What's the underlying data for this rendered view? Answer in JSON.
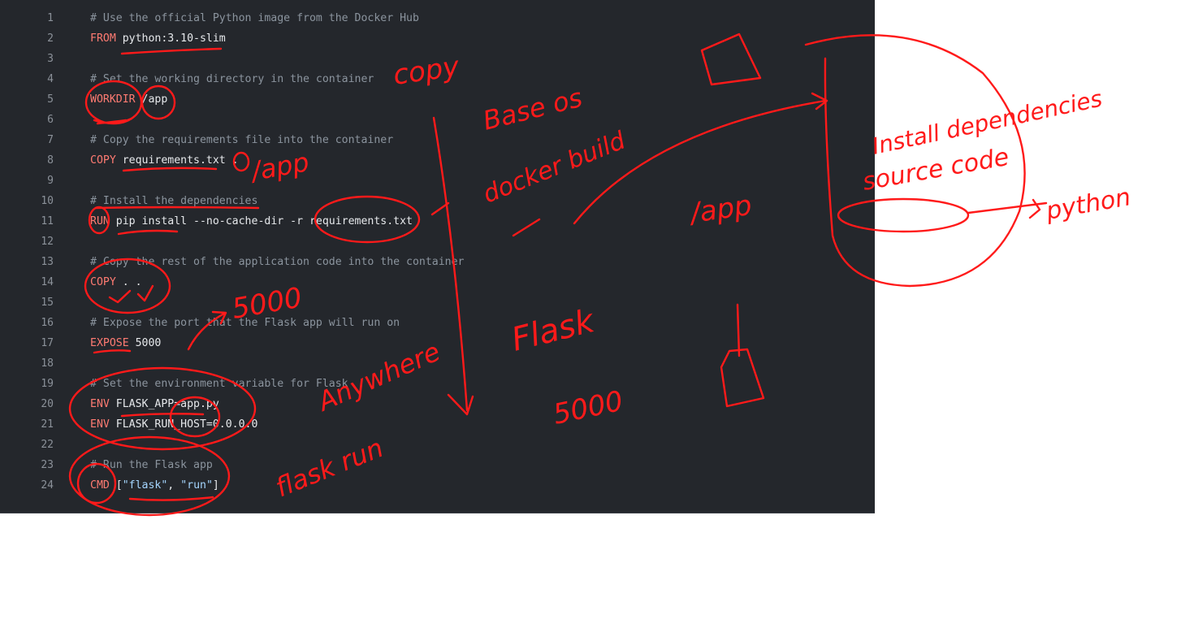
{
  "editor": {
    "lines": [
      {
        "n": "1",
        "parts": [
          {
            "t": "# Use the official Python image from the Docker Hub",
            "c": "cm"
          }
        ]
      },
      {
        "n": "2",
        "parts": [
          {
            "t": "FROM",
            "c": "kw"
          },
          {
            "t": " python:3.10-slim",
            "c": "tx"
          }
        ]
      },
      {
        "n": "3",
        "parts": []
      },
      {
        "n": "4",
        "parts": [
          {
            "t": "# Set the working directory in the container",
            "c": "cm"
          }
        ]
      },
      {
        "n": "5",
        "parts": [
          {
            "t": "WORKDIR",
            "c": "kw"
          },
          {
            "t": " /app",
            "c": "tx"
          }
        ]
      },
      {
        "n": "6",
        "parts": []
      },
      {
        "n": "7",
        "parts": [
          {
            "t": "# Copy the requirements file into the container",
            "c": "cm"
          }
        ]
      },
      {
        "n": "8",
        "parts": [
          {
            "t": "COPY",
            "c": "kw"
          },
          {
            "t": " requirements.txt .",
            "c": "tx"
          }
        ]
      },
      {
        "n": "9",
        "parts": []
      },
      {
        "n": "10",
        "parts": [
          {
            "t": "# Install the dependencies",
            "c": "cm"
          }
        ]
      },
      {
        "n": "11",
        "parts": [
          {
            "t": "RUN",
            "c": "kw"
          },
          {
            "t": " pip install --no-cache-dir -r requirements.txt",
            "c": "tx"
          }
        ]
      },
      {
        "n": "12",
        "parts": []
      },
      {
        "n": "13",
        "parts": [
          {
            "t": "# Copy the rest of the application code into the container",
            "c": "cm"
          }
        ]
      },
      {
        "n": "14",
        "parts": [
          {
            "t": "COPY",
            "c": "kw"
          },
          {
            "t": " . .",
            "c": "tx"
          }
        ]
      },
      {
        "n": "15",
        "parts": []
      },
      {
        "n": "16",
        "parts": [
          {
            "t": "# Expose the port that the Flask app will run on",
            "c": "cm"
          }
        ]
      },
      {
        "n": "17",
        "parts": [
          {
            "t": "EXPOSE",
            "c": "kw"
          },
          {
            "t": " 5000",
            "c": "tx"
          }
        ]
      },
      {
        "n": "18",
        "parts": []
      },
      {
        "n": "19",
        "parts": [
          {
            "t": "# Set the environment variable for Flask",
            "c": "cm"
          }
        ]
      },
      {
        "n": "20",
        "parts": [
          {
            "t": "ENV",
            "c": "kw"
          },
          {
            "t": " FLASK_APP=app.py",
            "c": "tx"
          }
        ]
      },
      {
        "n": "21",
        "parts": [
          {
            "t": "ENV",
            "c": "kw"
          },
          {
            "t": " FLASK_RUN_HOST=0.0.0.0",
            "c": "tx"
          }
        ]
      },
      {
        "n": "22",
        "parts": []
      },
      {
        "n": "23",
        "parts": [
          {
            "t": "# Run the Flask app",
            "c": "cm"
          }
        ]
      },
      {
        "n": "24",
        "parts": [
          {
            "t": "CMD",
            "c": "kw"
          },
          {
            "t": " [",
            "c": "tx"
          },
          {
            "t": "\"flask\"",
            "c": "str"
          },
          {
            "t": ", ",
            "c": "tx"
          },
          {
            "t": "\"run\"",
            "c": "str"
          },
          {
            "t": "]",
            "c": "tx"
          }
        ]
      }
    ]
  },
  "annotations": {
    "copy_note": "copy",
    "app_note_1": "/app",
    "base_os": "Base os",
    "docker_build": "docker build",
    "app_note_2": "/app",
    "install_dependencies": "Install dependencies",
    "source_code": "source code",
    "python": "python",
    "port_note": "5000",
    "flask_note": "Flask",
    "flask_port": "5000",
    "anywhere": "Anywhere",
    "flask_run": "flask run"
  },
  "colors": {
    "editor_bg": "#24272c",
    "keyword": "#ff7b72",
    "comment": "#8b949e",
    "string": "#a5d6ff",
    "ink": "#ff1a1a"
  }
}
